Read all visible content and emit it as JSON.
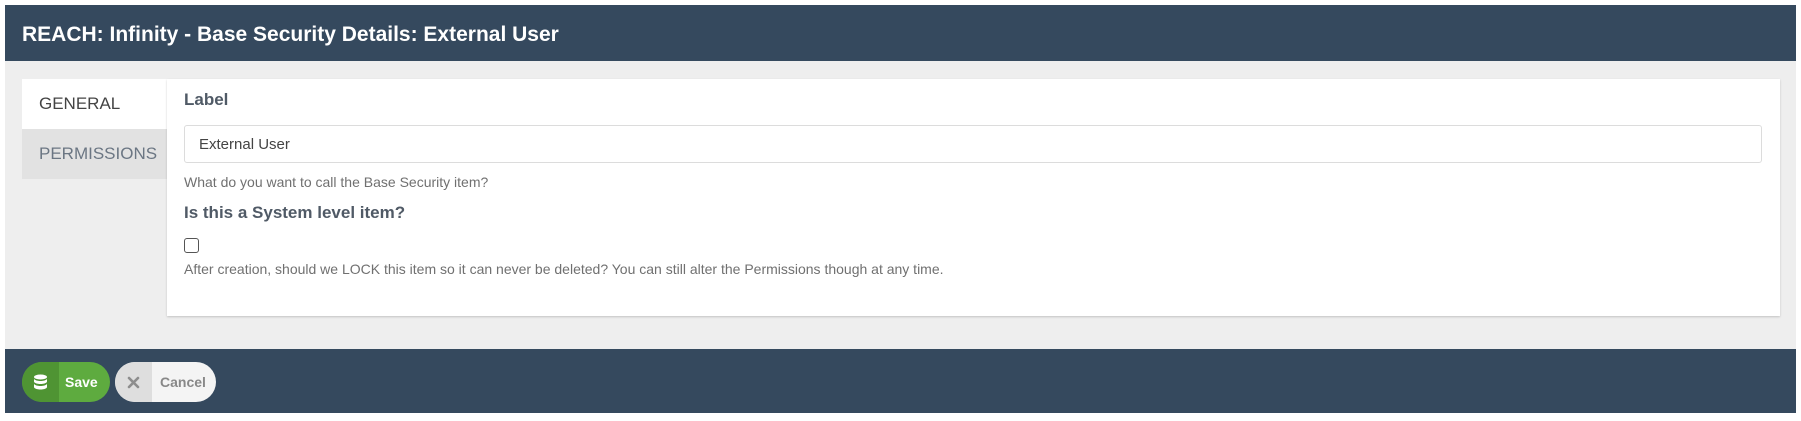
{
  "window": {
    "title": "REACH: Infinity - Base Security Details: External User"
  },
  "tabs": [
    {
      "label": "GENERAL",
      "active": true
    },
    {
      "label": "PERMISSIONS",
      "active": false
    }
  ],
  "form": {
    "label_field": {
      "label": "Label",
      "value": "External User",
      "help": "What do you want to call the Base Security item?"
    },
    "system_field": {
      "label": "Is this a System level item?",
      "checked": false,
      "help": "After creation, should we LOCK this item so it can never be deleted? You can still alter the Permissions though at any time."
    }
  },
  "footer": {
    "save_label": "Save",
    "save_icon": "database-icon",
    "cancel_label": "Cancel",
    "cancel_icon": "close-icon"
  },
  "colors": {
    "header_bg": "#35495e",
    "save_green": "#5eab3f",
    "page_bg": "#eeeeee"
  }
}
